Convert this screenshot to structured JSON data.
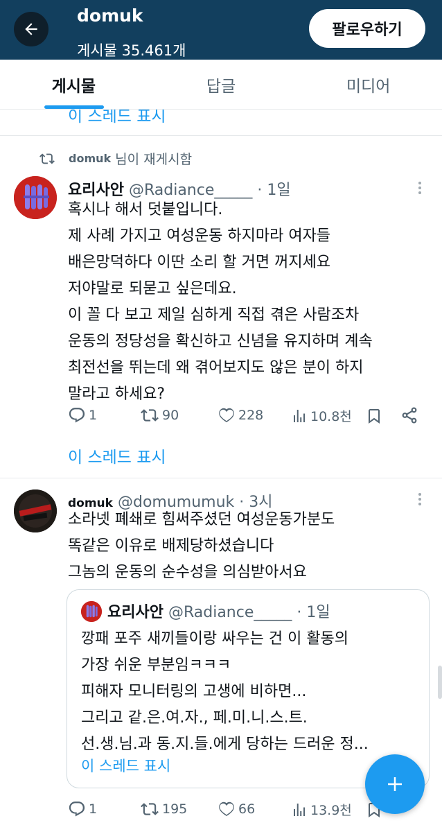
{
  "header": {
    "name": "domuk",
    "post_count": "게시물 35.461개",
    "follow_label": "팔로우하기"
  },
  "tabs": [
    {
      "label": "게시물",
      "active": true
    },
    {
      "label": "답글",
      "active": false
    },
    {
      "label": "미디어",
      "active": false
    }
  ],
  "partial_thread_link": "이 스레드 표시",
  "repost_notice": {
    "name": "domuk",
    "suffix": "님이 재게시함"
  },
  "tweet1": {
    "name": "요리사안",
    "handle": "@Radiance_____ · 1일",
    "lines": [
      "혹시나 해서 덧붙입니다.",
      "제 사례 가지고 여성운동 하지마라 여자들",
      "배은망덕하다 이딴 소리 할 거면 꺼지세요",
      "저야말로 되묻고 싶은데요.",
      "이 꼴 다 보고 제일 심하게 직접 겪은 사람조차",
      "운동의 정당성을 확신하고 신념을 유지하며 계속",
      "최전선을 뛰는데 왜 겪어보지도 않은 분이 하지",
      "말라고 하세요?"
    ],
    "replies": "1",
    "reposts": "90",
    "likes": "228",
    "views": "10.8천",
    "thread_link": "이 스레드 표시"
  },
  "tweet2": {
    "name": "domuk",
    "handle": "@domumumuk · 3시",
    "lines": [
      "소라넷 폐쇄로 힘써주셨던 여성운동가분도",
      "똑같은 이유로 배제당하셨습니다",
      "그놈의 운동의 순수성을 의심받아서요"
    ],
    "quote": {
      "name": "요리사안",
      "handle": "@Radiance_____ · 1일",
      "lines": [
        "깡패 포주 새끼들이랑 싸우는 건 이 활동의",
        "가장 쉬운 부분임ㅋㅋㅋ",
        "피해자 모니터링의 고생에 비하면...",
        "그리고 같.은.여.자., 페.미.니.스.트.",
        "선.생.님.과 동.지.들.에게 당하는 드러운 정..."
      ],
      "thread_link": "이 스레드 표시"
    },
    "replies": "1",
    "reposts": "195",
    "likes": "66",
    "views": "13.9천"
  },
  "colors": {
    "header_bg": "#123f5e",
    "accent": "#1d9bf0",
    "muted": "#536471"
  },
  "icons": [
    "back-arrow-icon",
    "repost-icon",
    "reply-icon",
    "like-icon",
    "views-icon",
    "bookmark-icon",
    "share-icon",
    "more-icon",
    "plus-icon"
  ]
}
